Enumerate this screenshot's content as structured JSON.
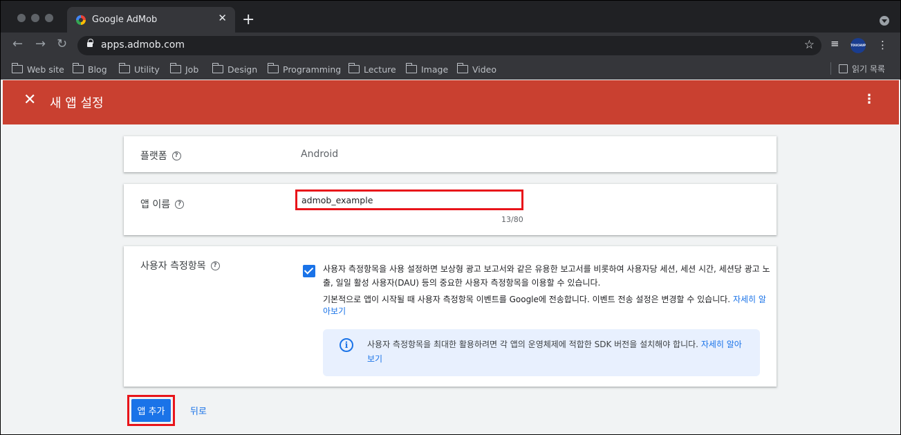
{
  "browser": {
    "tab_title": "Google AdMob",
    "tab_close": "✕",
    "new_tab": "+",
    "url": "apps.admob.com",
    "bookmarks": [
      "Web site",
      "Blog",
      "Utility",
      "Job",
      "Design",
      "Programming",
      "Lecture",
      "Image",
      "Video"
    ],
    "reading_list": "읽기 목록",
    "avatar_text": "TOUCHUP"
  },
  "appbar": {
    "title": "새 앱 설정"
  },
  "platform": {
    "label": "플랫폼",
    "value": "Android"
  },
  "app_name": {
    "label": "앱 이름",
    "value": "admob_example",
    "counter": "13/80"
  },
  "metrics": {
    "label": "사용자 측정항목",
    "checked": true,
    "description": "사용자 측정항목을 사용 설정하면 보상형 광고 보고서와 같은 유용한 보고서를 비롯하여 사용자당 세션, 세션 시간, 세션당 광고 노출, 일일 활성 사용자(DAU) 등의 중요한 사용자 측정항목을 이용할 수 있습니다.",
    "note": "기본적으로 앱이 시작될 때 사용자 측정항목 이벤트를 Google에 전송합니다. 이벤트 전송 설정은 변경할 수 있습니다.",
    "note_link": "자세히 알아보기",
    "info_text": "사용자 측정항목을 최대한 활용하려면 각 앱의 운영체제에 적합한 SDK 버전을 설치해야 합니다.",
    "info_link": "자세히 알아보기"
  },
  "actions": {
    "add": "앱 추가",
    "back": "뒤로"
  },
  "colors": {
    "appbar": "#c94030",
    "accent": "#1a73e8",
    "highlight": "#e8141a"
  }
}
